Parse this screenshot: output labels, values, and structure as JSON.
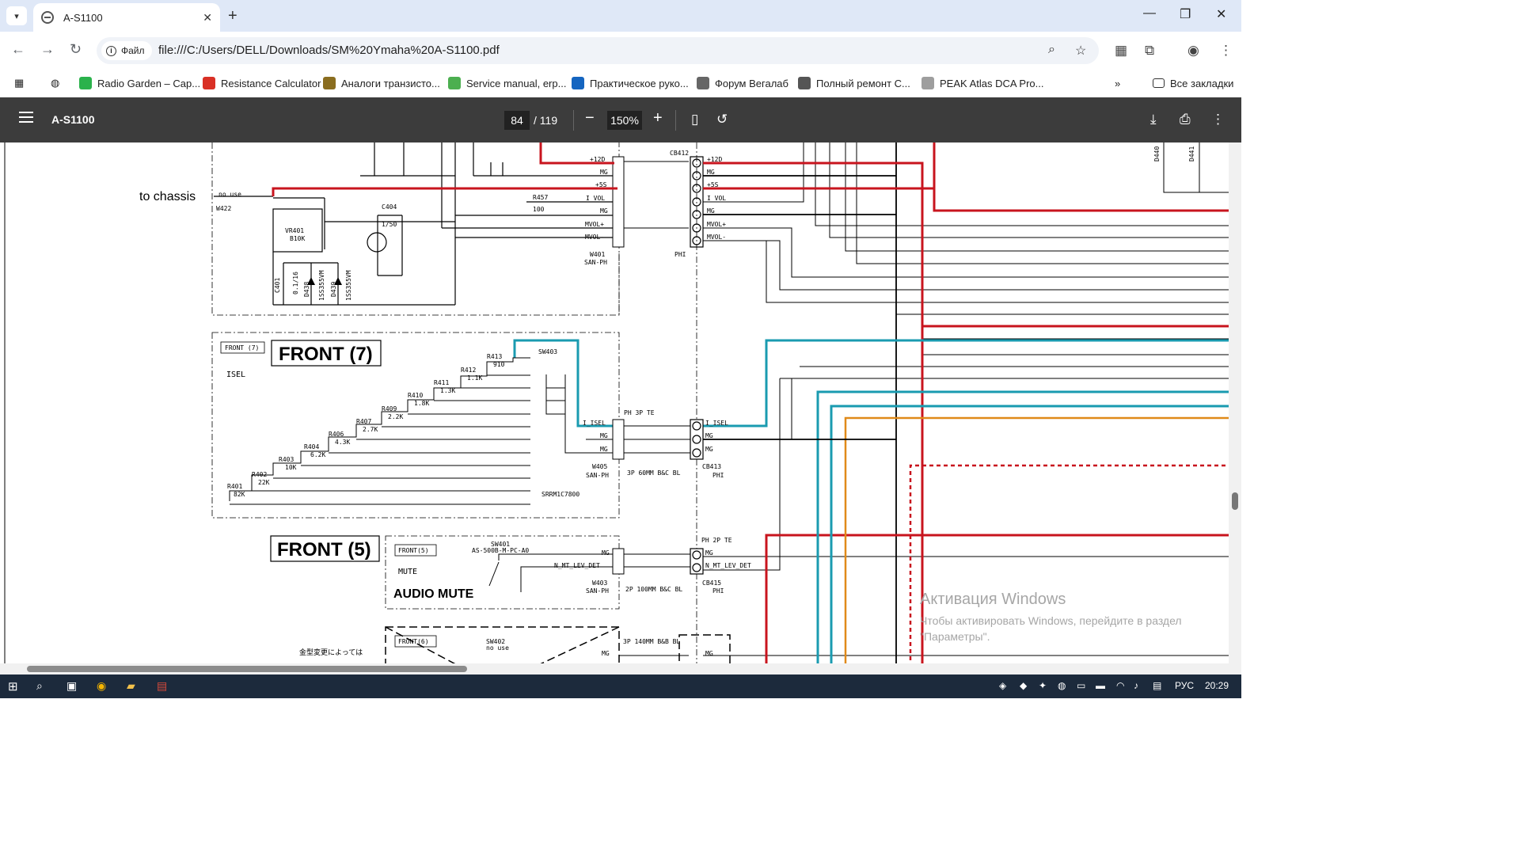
{
  "browser": {
    "tab_title": "A-S1100",
    "tab_close": "✕",
    "new_tab": "+",
    "url": "file:///C:/Users/DELL/Downloads/SM%20Ymaha%20A-S1100.pdf",
    "site_chip": "Файл",
    "window_controls": [
      "—",
      "❐",
      "✕"
    ]
  },
  "bookmarks": [
    {
      "label": "Radio Garden – Cap...",
      "color": "#2bb24c"
    },
    {
      "label": "Resistance Calculator",
      "color": "#d93025"
    },
    {
      "label": "Аналоги транзисто...",
      "color": "#8a6d1f"
    },
    {
      "label": "Service manual, erp...",
      "color": "#4caf50"
    },
    {
      "label": "Практическое руко...",
      "color": "#1565c0"
    },
    {
      "label": "Форум Вегалаб",
      "color": "#666666"
    },
    {
      "label": "Полный ремонт С...",
      "color": "#555555"
    },
    {
      "label": "PEAK Atlas DCA Pro...",
      "color": "#9e9e9e"
    }
  ],
  "bookmarks_more": "»",
  "bookmarks_all": "Все закладки",
  "pdf": {
    "title": "A-S1100",
    "page_current": "84",
    "page_total": "/ 119",
    "zoom": "150%",
    "zoom_out": "−",
    "zoom_in": "+"
  },
  "schematic": {
    "to_chassis": "to chassis",
    "front7_box": "FRONT (7)",
    "front7_title": "FRONT (7)",
    "isel": "ISEL",
    "front5_title": "FRONT (5)",
    "front5_box": "FRONT(5)",
    "mute": "MUTE",
    "audio_mute": "AUDIO MUTE",
    "front6_box": "FRONT(6)",
    "jp_note": "金型変更によっては",
    "w422": "W422",
    "no_use": "no use",
    "vr401": "VR401",
    "b10k": "B10K",
    "w401": "W401",
    "san_ph": "SAN-PH",
    "phi": "PHI",
    "cb412": "CB412",
    "r457": "R457",
    "r457v": "100",
    "c404": "C404",
    "c404v": "1/50",
    "c401": "C401",
    "d438": "D438",
    "d439": "D439",
    "d_type": "1SS355VM",
    "c401v": "0.1/16",
    "net_labels": [
      "+12D",
      "MG",
      "+5S",
      "I_VOL",
      "MG",
      "MVOL+",
      "MVOL-"
    ],
    "sw403": "SW403",
    "sw403_type": "SRRM1C7800",
    "resistors": [
      {
        "ref": "R413",
        "val": "910"
      },
      {
        "ref": "R412",
        "val": "1.1K"
      },
      {
        "ref": "R411",
        "val": "1.3K"
      },
      {
        "ref": "R410",
        "val": "1.8K"
      },
      {
        "ref": "R409",
        "val": "2.2K"
      },
      {
        "ref": "R407",
        "val": "2.7K"
      },
      {
        "ref": "R406",
        "val": "4.3K"
      },
      {
        "ref": "R404",
        "val": "6.2K"
      },
      {
        "ref": "R403",
        "val": "10K"
      },
      {
        "ref": "R402",
        "val": "22K"
      },
      {
        "ref": "R401",
        "val": "82K"
      }
    ],
    "w405": "W405",
    "ph3pte": "PH 3P TE",
    "cable3p": "3P 60MM B&C BL",
    "cb413": "CB413",
    "i_isel": "I_ISEL",
    "mg": "MG",
    "sw401": "SW401",
    "sw401_type": "AS-500B-M-PC-A0",
    "n_mt": "N_MT_LEV_DET",
    "w403": "W403",
    "ph2pte": "PH 2P TE",
    "cable2p": "2P 100MM B&C BL",
    "cb415": "CB415",
    "sw402": "SW402",
    "cable140": "3P 140MM B&B BL",
    "d440": "D440",
    "d441": "D441"
  },
  "activation": {
    "title": "Активация Windows",
    "text": "Чтобы активировать Windows, перейдите в раздел \"Параметры\"."
  },
  "taskbar": {
    "lang": "РУС",
    "time": "20:29"
  },
  "colors": {
    "red_wire": "#c8141e",
    "cyan_wire": "#1a9bb0",
    "orange_wire": "#e08a1a",
    "pdf_toolbar": "#3c3c3c",
    "taskbar": "#1c2a3c"
  }
}
